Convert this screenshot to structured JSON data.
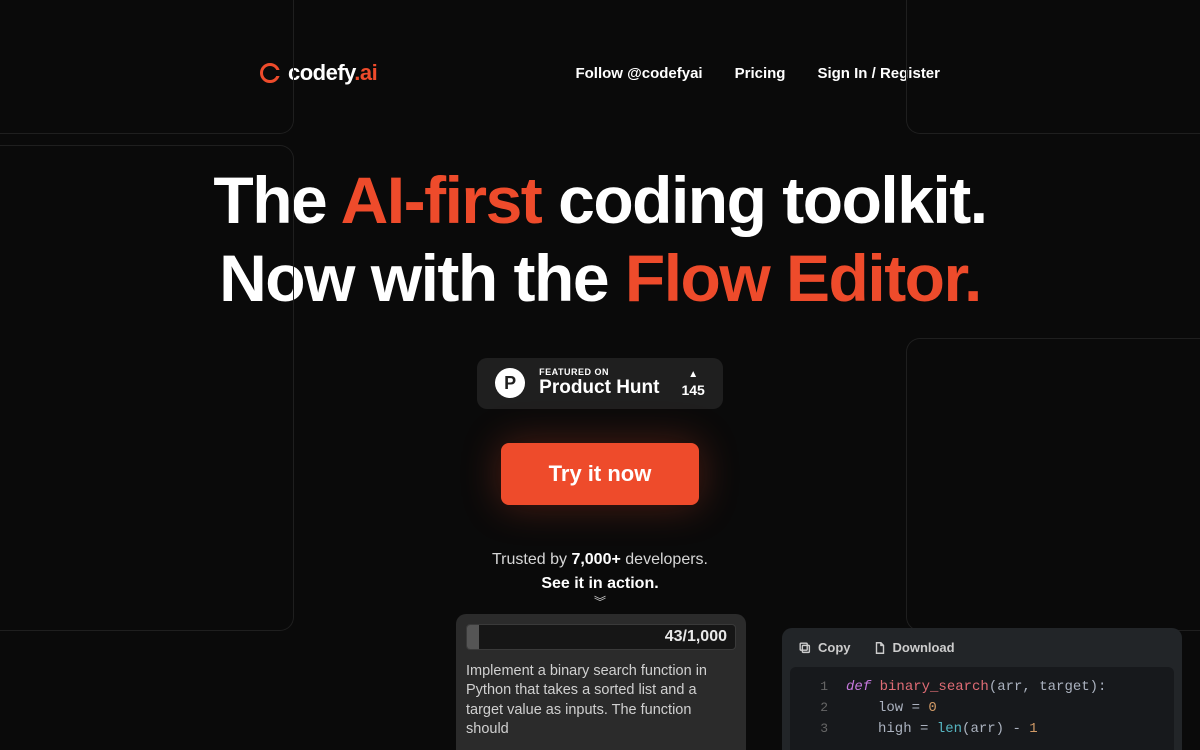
{
  "brand": {
    "name": "codefy",
    "suffix": ".ai"
  },
  "nav": {
    "follow": "Follow @codefyai",
    "pricing": "Pricing",
    "signin": "Sign In / Register"
  },
  "hero": {
    "l1_pre": "The ",
    "l1_accent": "AI-first",
    "l1_post": " coding toolkit.",
    "l2_pre": "Now with the ",
    "l2_accent": "Flow Editor."
  },
  "ph": {
    "featured": "FEATURED ON",
    "name": "Product Hunt",
    "count": "145",
    "letter": "P"
  },
  "cta": {
    "label": "Try it now"
  },
  "trust": {
    "pre": "Trusted by ",
    "count": "7,000+",
    "post": " developers.",
    "see": "See it in action."
  },
  "prompt": {
    "counter": "43/1,000",
    "text": "Implement a binary search function in Python that takes a sorted list and a target value as inputs. The function should"
  },
  "code": {
    "copy": "Copy",
    "download": "Download",
    "lines": [
      {
        "n": "1",
        "kw": "def ",
        "fn": "binary_search",
        "rest1": "(arr, target):"
      },
      {
        "n": "2",
        "indent": true,
        "v1": "low ",
        "op": "= ",
        "num": "0"
      },
      {
        "n": "3",
        "indent": true,
        "v1": "high ",
        "op": "= ",
        "bi": "len",
        "rest1": "(arr) ",
        "op2": "- ",
        "num": "1"
      }
    ]
  }
}
